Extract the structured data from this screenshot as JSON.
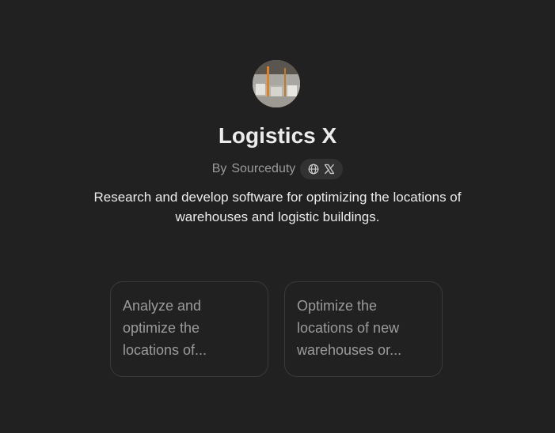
{
  "gpt": {
    "name": "Logistics X",
    "author_prefix": "By",
    "author": "Sourceduty",
    "description": "Research and develop software for optimizing the locations of warehouses and logistic buildings."
  },
  "social_links": [
    {
      "icon": "globe-icon"
    },
    {
      "icon": "x-logo-icon"
    }
  ],
  "conversation_starters": [
    {
      "label": "Analyze and optimize the locations of..."
    },
    {
      "label": "Optimize the locations of new warehouses or..."
    }
  ],
  "colors": {
    "background": "#212121",
    "text_primary": "#ececec",
    "text_secondary": "#9b9b9b",
    "card_border": "#3a3a3a",
    "pill_background": "#323232"
  }
}
